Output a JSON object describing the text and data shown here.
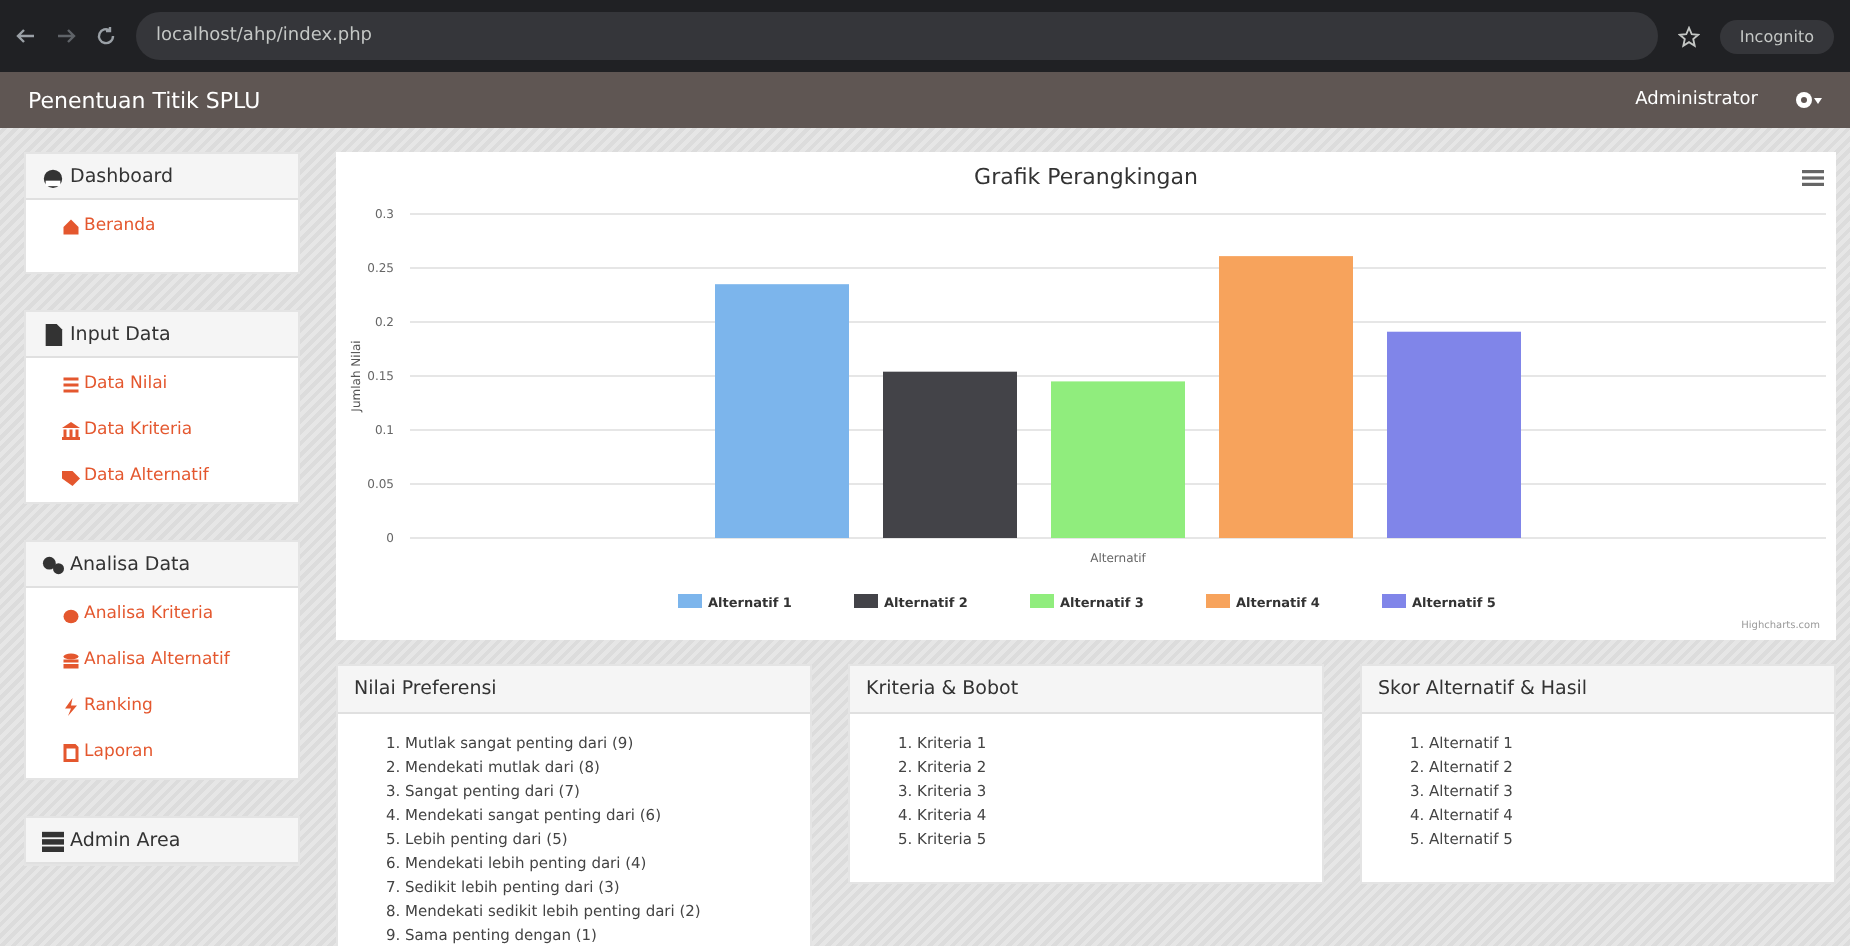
{
  "browser": {
    "url": "localhost/ahp/index.php",
    "profile": "Incognito"
  },
  "navbar": {
    "title": "Penentuan Titik SPLU",
    "user": "Administrator"
  },
  "sidebar": [
    {
      "title": "Dashboard",
      "items": [
        "Beranda"
      ]
    },
    {
      "title": "Input Data",
      "items": [
        "Data Nilai",
        "Data Kriteria",
        "Data Alternatif"
      ]
    },
    {
      "title": "Analisa Data",
      "items": [
        "Analisa Kriteria",
        "Analisa Alternatif",
        "Ranking",
        "Laporan"
      ]
    },
    {
      "title": "Admin Area"
    }
  ],
  "chart": {
    "chart_data": {
      "type": "bar",
      "title": "Grafik Perangkingan",
      "grid": true,
      "legend": "bottom",
      "ylabel": "Jumlah Nilai",
      "categories": [
        "Alternatif"
      ],
      "ylim": [
        0,
        0.3
      ],
      "yticks": [
        0,
        0.05,
        0.1,
        0.15,
        0.2,
        0.25,
        0.3
      ],
      "series": [
        {
          "name": "Alternatif 1",
          "color": "#7cb5ec",
          "values": [
            0.235
          ]
        },
        {
          "name": "Alternatif 2",
          "color": "#434348",
          "values": [
            0.154
          ]
        },
        {
          "name": "Alternatif 3",
          "color": "#90ed7d",
          "values": [
            0.145
          ]
        },
        {
          "name": "Alternatif 4",
          "color": "#f7a35c",
          "values": [
            0.261
          ]
        },
        {
          "name": "Alternatif 5",
          "color": "#8085e9",
          "values": [
            0.191
          ]
        }
      ]
    },
    "credits": "Highcharts.com"
  },
  "panels": [
    {
      "title": "Nilai Preferensi",
      "items": [
        "1. Mutlak sangat penting dari (9)",
        "2. Mendekati mutlak dari (8)",
        "3. Sangat penting dari (7)",
        "4. Mendekati sangat penting dari (6)",
        "5. Lebih penting dari (5)",
        "6. Mendekati lebih penting dari (4)",
        "7. Sedikit lebih penting dari (3)",
        "8. Mendekati sedikit lebih penting dari (2)",
        "9. Sama penting dengan (1)"
      ]
    },
    {
      "title": "Kriteria & Bobot",
      "items": [
        "1. Kriteria 1",
        "2. Kriteria 2",
        "3. Kriteria 3",
        "4. Kriteria 4",
        "5. Kriteria 5"
      ]
    },
    {
      "title": "Skor Alternatif & Hasil",
      "items": [
        "1. Alternatif 1",
        "2. Alternatif 2",
        "3. Alternatif 3",
        "4. Alternatif 4",
        "5. Alternatif 5"
      ]
    }
  ]
}
